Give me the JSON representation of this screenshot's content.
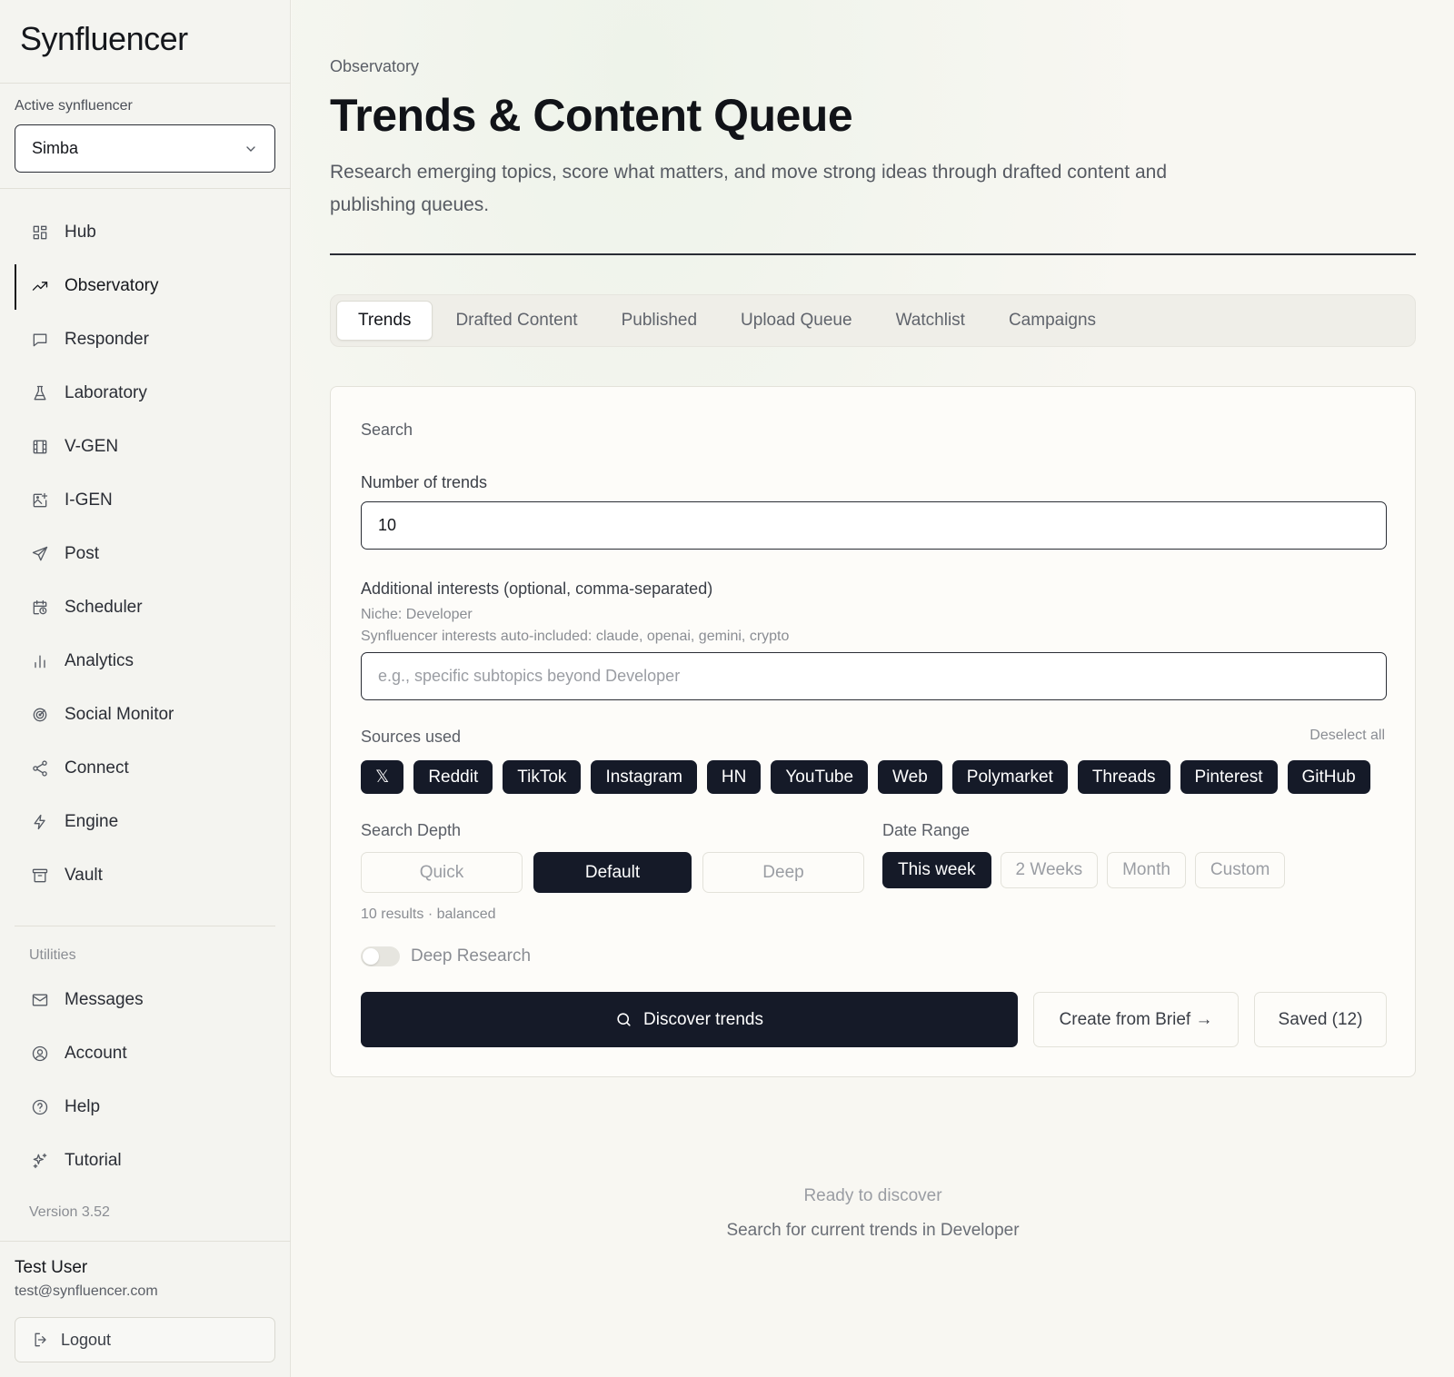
{
  "brand": {
    "logo_text": "Synfluencer"
  },
  "active": {
    "label": "Active synfluencer",
    "value": "Simba"
  },
  "nav": [
    {
      "label": "Hub",
      "icon": "grid-icon"
    },
    {
      "label": "Observatory",
      "icon": "trend-icon",
      "active": true
    },
    {
      "label": "Responder",
      "icon": "message-square-icon"
    },
    {
      "label": "Laboratory",
      "icon": "flask-icon"
    },
    {
      "label": "V-GEN",
      "icon": "film-icon"
    },
    {
      "label": "I-GEN",
      "icon": "image-plus-icon"
    },
    {
      "label": "Post",
      "icon": "send-icon"
    },
    {
      "label": "Scheduler",
      "icon": "calendar-clock-icon"
    },
    {
      "label": "Analytics",
      "icon": "bar-chart-icon"
    },
    {
      "label": "Social Monitor",
      "icon": "radar-icon"
    },
    {
      "label": "Connect",
      "icon": "share-icon"
    },
    {
      "label": "Engine",
      "icon": "zap-icon"
    },
    {
      "label": "Vault",
      "icon": "archive-icon"
    }
  ],
  "utilities": {
    "label": "Utilities",
    "items": [
      {
        "label": "Messages",
        "icon": "mail-icon"
      },
      {
        "label": "Account",
        "icon": "user-circle-icon"
      },
      {
        "label": "Help",
        "icon": "help-circle-icon"
      },
      {
        "label": "Tutorial",
        "icon": "sparkles-icon"
      }
    ]
  },
  "version": "Version 3.52",
  "user": {
    "name": "Test User",
    "email": "test@synfluencer.com",
    "logout": "Logout"
  },
  "header": {
    "breadcrumb": "Observatory",
    "title": "Trends & Content Queue",
    "subtitle": "Research emerging topics, score what matters, and move strong ideas through drafted content and publishing queues."
  },
  "tabs": [
    "Trends",
    "Drafted Content",
    "Published",
    "Upload Queue",
    "Watchlist",
    "Campaigns"
  ],
  "search": {
    "section_label": "Search",
    "num_label": "Number of trends",
    "num_value": "10",
    "interests_label": "Additional interests (optional, comma-separated)",
    "niche_note": "Niche: Developer",
    "auto_note": "Synfluencer interests auto-included: claude, openai, gemini, crypto",
    "interests_placeholder": "e.g., specific subtopics beyond Developer",
    "sources_label": "Sources used",
    "deselect": "Deselect all",
    "sources": [
      "𝕏",
      "Reddit",
      "TikTok",
      "Instagram",
      "HN",
      "YouTube",
      "Web",
      "Polymarket",
      "Threads",
      "Pinterest",
      "GitHub"
    ],
    "depth_label": "Search Depth",
    "depth_options": [
      "Quick",
      "Default",
      "Deep"
    ],
    "depth_note": "10 results · balanced",
    "range_label": "Date Range",
    "range_options": [
      "This week",
      "2 Weeks",
      "Month",
      "Custom"
    ],
    "deep_research": "Deep Research",
    "discover": "Discover trends",
    "create_brief": "Create from Brief →",
    "saved": "Saved (12)"
  },
  "empty": {
    "title": "Ready to discover",
    "subtitle": "Search for current trends in Developer"
  }
}
